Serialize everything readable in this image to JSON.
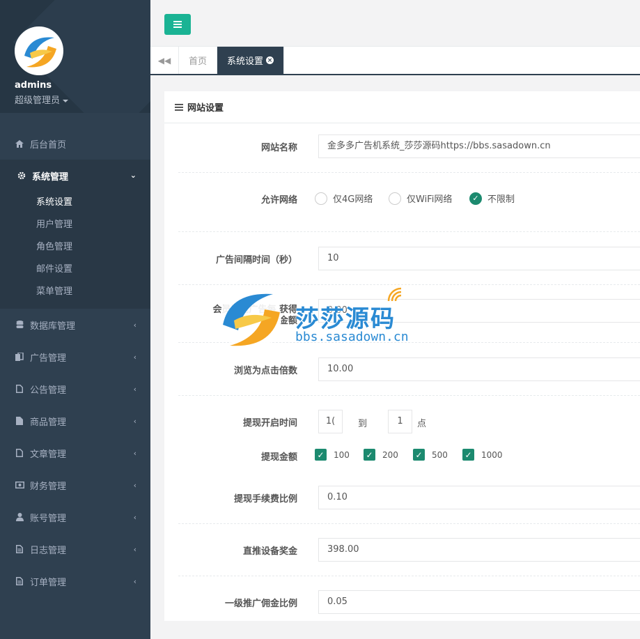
{
  "sidebar": {
    "user_name": "admins",
    "user_role": "超级管理员",
    "menu": [
      {
        "label": "后台首页",
        "icon": "home-icon"
      },
      {
        "label": "系统管理",
        "icon": "gear-icon"
      },
      {
        "label": "数据库管理",
        "icon": "database-icon"
      },
      {
        "label": "广告管理",
        "icon": "copy-icon"
      },
      {
        "label": "公告管理",
        "icon": "file-icon"
      },
      {
        "label": "商品管理",
        "icon": "file-icon"
      },
      {
        "label": "文章管理",
        "icon": "file-icon"
      },
      {
        "label": "财务管理",
        "icon": "money-icon"
      },
      {
        "label": "账号管理",
        "icon": "user-icon"
      },
      {
        "label": "日志管理",
        "icon": "list-icon"
      },
      {
        "label": "订单管理",
        "icon": "list-icon"
      }
    ],
    "submenu": [
      "系统设置",
      "用户管理",
      "角色管理",
      "邮件设置",
      "菜单管理"
    ]
  },
  "tabs": {
    "home": "首页",
    "current": "系统设置"
  },
  "panel": {
    "title": "网站设置"
  },
  "form": {
    "site_name_label": "网站名称",
    "site_name_value": "金多多广告机系统_莎莎源码https://bbs.sasadown.cn",
    "network_label": "允许网络",
    "network_options": [
      "仅4G网络",
      "仅WiFi网络",
      "不限制"
    ],
    "network_selected": "不限制",
    "ad_interval_label": "广告间隔时间（秒）",
    "ad_interval_value": "10",
    "member_reward_label_1": "会员浏览广告每",
    "member_reward_label_2": "获得",
    "member_reward_label_3": "金额",
    "member_reward_value": "0.00",
    "click_multiplier_label": "浏览为点击倍数",
    "click_multiplier_value": "10.00",
    "withdraw_time_label": "提现开启时间",
    "withdraw_time_start": "1(",
    "withdraw_time_to": "到",
    "withdraw_time_end": "1",
    "withdraw_time_unit": "点",
    "withdraw_amount_label": "提现金额",
    "withdraw_amounts": [
      "100",
      "200",
      "500",
      "1000"
    ],
    "fee_ratio_label": "提现手续费比例",
    "fee_ratio_value": "0.10",
    "device_bonus_label": "直推设备奖金",
    "device_bonus_value": "398.00",
    "commission_label": "一级推广佣金比例",
    "commission_value": "0.05"
  },
  "watermark": {
    "title": "莎莎源码",
    "url": "bbs.sasadown.cn"
  },
  "colors": {
    "sidebar_bg": "#2f4050",
    "accent": "#1ab394",
    "check": "#1c8a6f"
  }
}
